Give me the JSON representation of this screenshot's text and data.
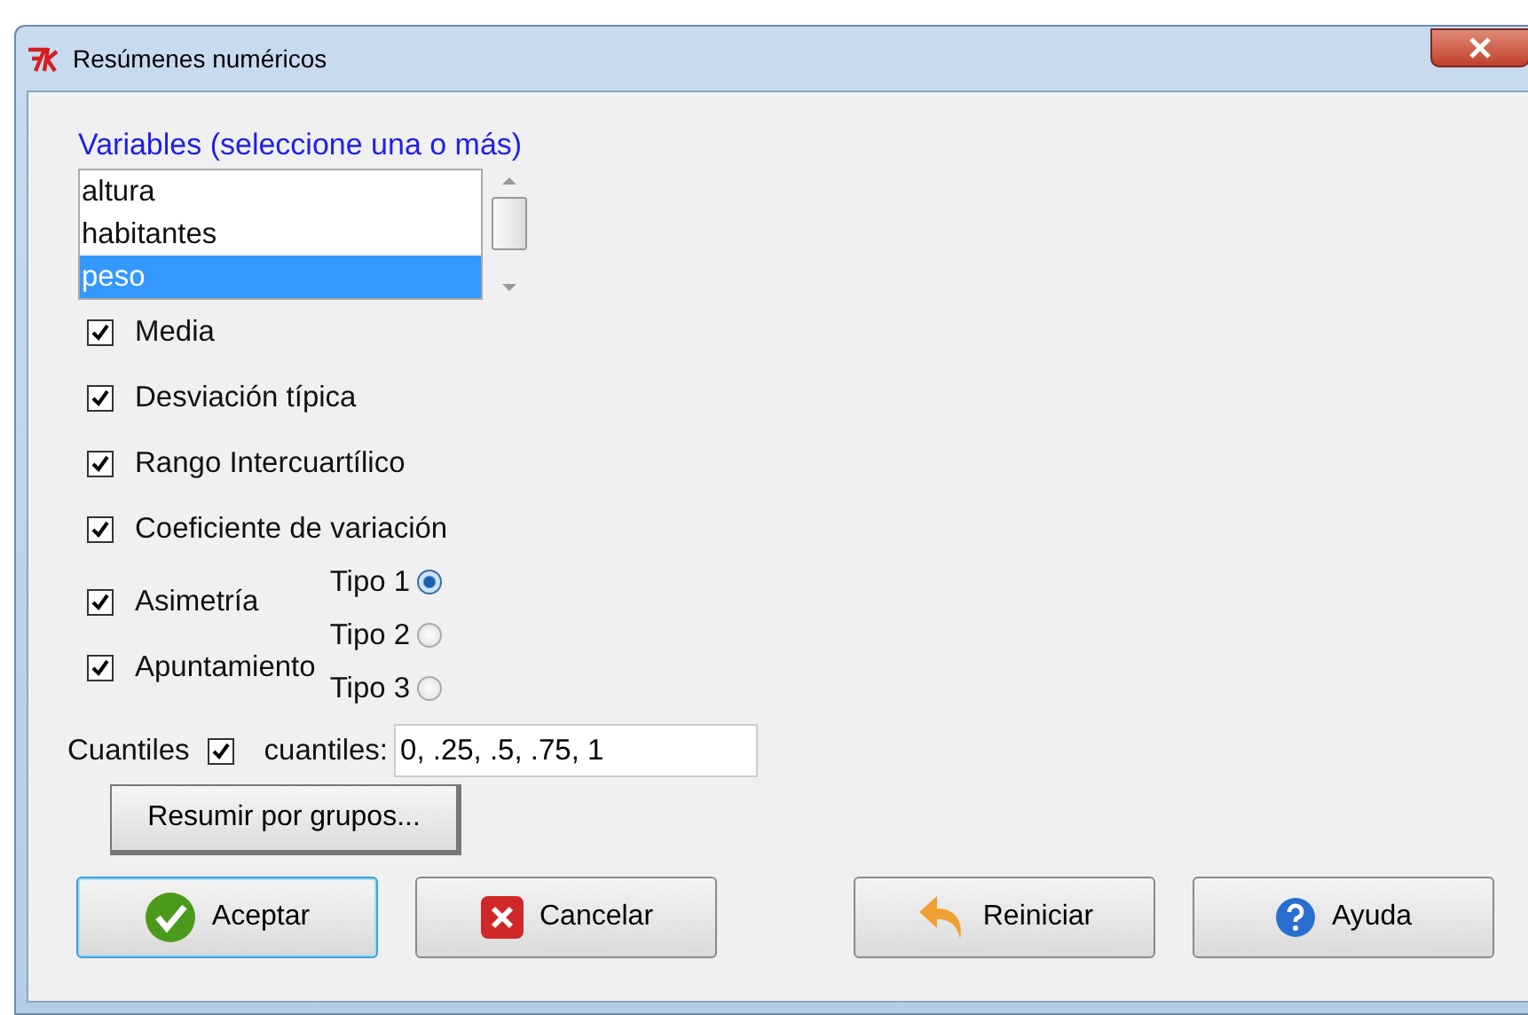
{
  "window": {
    "title": "Resúmenes numéricos"
  },
  "variables": {
    "label": "Variables (seleccione una o más)",
    "items": [
      {
        "name": "altura",
        "selected": false
      },
      {
        "name": "habitantes",
        "selected": false
      },
      {
        "name": "peso",
        "selected": true
      }
    ]
  },
  "options": [
    {
      "label": "Media",
      "checked": true
    },
    {
      "label": "Desviación típica",
      "checked": true
    },
    {
      "label": "Rango Intercuartílico",
      "checked": true
    },
    {
      "label": "Coeficiente de variación",
      "checked": true
    },
    {
      "label": "Asimetría",
      "checked": true
    },
    {
      "label": "Apuntamiento",
      "checked": true
    }
  ],
  "types": [
    {
      "label": "Tipo 1",
      "selected": true
    },
    {
      "label": "Tipo 2",
      "selected": false
    },
    {
      "label": "Tipo 3",
      "selected": false
    }
  ],
  "quantiles": {
    "label": "Cuantiles",
    "checked": true,
    "field_label": "cuantiles:",
    "value": "0, .25, .5, .75, 1"
  },
  "group_button": "Resumir por grupos...",
  "buttons": [
    {
      "label": "Aceptar",
      "kind": "ok",
      "focused": true
    },
    {
      "label": "Cancelar",
      "kind": "cancel",
      "focused": false
    },
    {
      "label": "Reiniciar",
      "kind": "reset",
      "focused": false
    },
    {
      "label": "Ayuda",
      "kind": "help",
      "focused": false
    }
  ]
}
